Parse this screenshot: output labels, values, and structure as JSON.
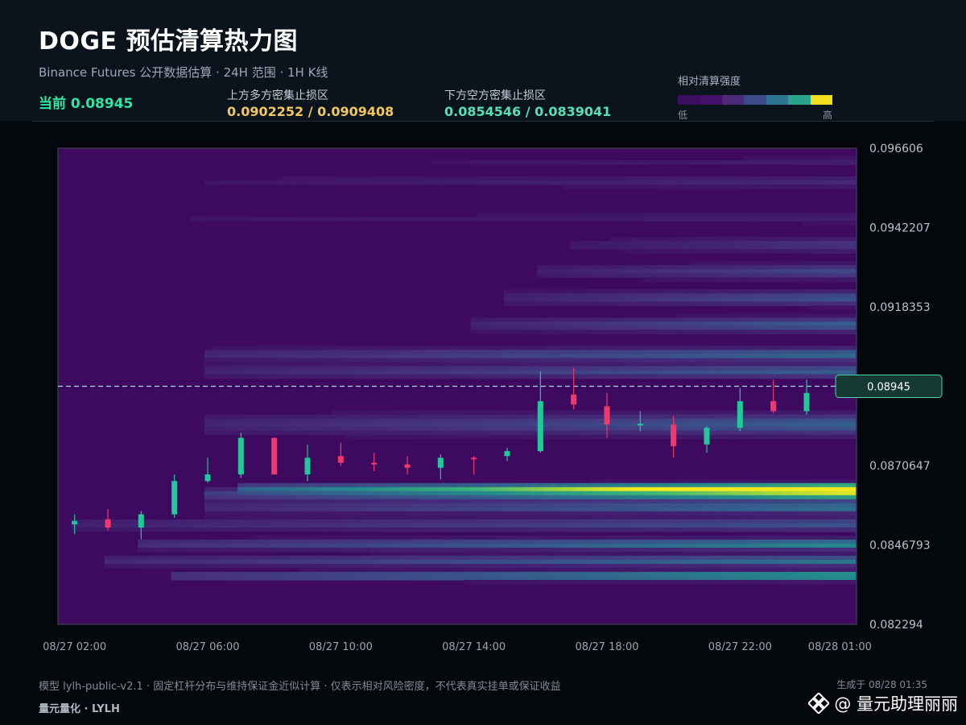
{
  "header": {
    "title": "DOGE 预估清算热力图",
    "subtitle": "Binance Futures 公开数据估算 · 24H 范围 · 1H K线",
    "current_label": "当前 0.08945",
    "upper_label": "上方多方密集止损区",
    "upper_value": "0.0902252 / 0.0909408",
    "lower_label": "下方空方密集止损区",
    "lower_value": "0.0854546 / 0.0839041"
  },
  "legend": {
    "label": "相对清算强度",
    "low": "低",
    "high": "高",
    "colors": [
      "#3a0f5e",
      "#45106a",
      "#4b2a7a",
      "#3d4a8a",
      "#2f7490",
      "#2aa38c",
      "#f0e020"
    ]
  },
  "chart_data": {
    "type": "heatmap",
    "ylim": [
      0.082294,
      0.096606
    ],
    "y_ticks": [
      "0.096606",
      "0.0942207",
      "0.0918353",
      "0.0894500",
      "0.0870647",
      "0.0846793",
      "0.082294"
    ],
    "y_tick_values": [
      0.096606,
      0.0942207,
      0.0918353,
      0.08945,
      0.0870647,
      0.0846793,
      0.082294
    ],
    "x_ticks": [
      "08/27 02:00",
      "08/27 06:00",
      "08/27 10:00",
      "08/27 14:00",
      "08/27 18:00",
      "08/27 22:00",
      "08/28 01:00"
    ],
    "x_tick_hours": [
      2,
      6,
      10,
      14,
      18,
      22,
      25
    ],
    "x_range_hours": [
      1.5,
      25.5
    ],
    "current_price": 0.08945,
    "current_price_label": "0.08945",
    "candles": [
      {
        "hour": 2,
        "open": 0.0853,
        "close": 0.0854,
        "high": 0.0856,
        "low": 0.085
      },
      {
        "hour": 3,
        "open": 0.08545,
        "close": 0.0852,
        "high": 0.08575,
        "low": 0.0851
      },
      {
        "hour": 4,
        "open": 0.0852,
        "close": 0.0856,
        "high": 0.0857,
        "low": 0.08485
      },
      {
        "hour": 5,
        "open": 0.0856,
        "close": 0.0866,
        "high": 0.0868,
        "low": 0.0855
      },
      {
        "hour": 6,
        "open": 0.0866,
        "close": 0.0868,
        "high": 0.0873,
        "low": 0.08655
      },
      {
        "hour": 7,
        "open": 0.0868,
        "close": 0.0879,
        "high": 0.08805,
        "low": 0.0867
      },
      {
        "hour": 8,
        "open": 0.0879,
        "close": 0.0868,
        "high": 0.0879,
        "low": 0.0868
      },
      {
        "hour": 9,
        "open": 0.0868,
        "close": 0.0873,
        "high": 0.0877,
        "low": 0.0866
      },
      {
        "hour": 10,
        "open": 0.08735,
        "close": 0.08715,
        "high": 0.08775,
        "low": 0.08705
      },
      {
        "hour": 11,
        "open": 0.08715,
        "close": 0.0871,
        "high": 0.08745,
        "low": 0.0869
      },
      {
        "hour": 12,
        "open": 0.0871,
        "close": 0.087,
        "high": 0.08735,
        "low": 0.0868
      },
      {
        "hour": 13,
        "open": 0.087,
        "close": 0.0873,
        "high": 0.0874,
        "low": 0.08665
      },
      {
        "hour": 14,
        "open": 0.0873,
        "close": 0.08728,
        "high": 0.08735,
        "low": 0.0868
      },
      {
        "hour": 15,
        "open": 0.08735,
        "close": 0.0875,
        "high": 0.0876,
        "low": 0.0872
      },
      {
        "hour": 16,
        "open": 0.0875,
        "close": 0.089,
        "high": 0.0899,
        "low": 0.08745
      },
      {
        "hour": 17,
        "open": 0.0892,
        "close": 0.0889,
        "high": 0.09,
        "low": 0.08875
      },
      {
        "hour": 18,
        "open": 0.08885,
        "close": 0.0883,
        "high": 0.08925,
        "low": 0.0879
      },
      {
        "hour": 19,
        "open": 0.0883,
        "close": 0.08832,
        "high": 0.0887,
        "low": 0.0881
      },
      {
        "hour": 20,
        "open": 0.0883,
        "close": 0.08765,
        "high": 0.08855,
        "low": 0.0873
      },
      {
        "hour": 21,
        "open": 0.0877,
        "close": 0.0882,
        "high": 0.08825,
        "low": 0.08745
      },
      {
        "hour": 22,
        "open": 0.0882,
        "close": 0.089,
        "high": 0.0894,
        "low": 0.0881
      },
      {
        "hour": 23,
        "open": 0.089,
        "close": 0.0887,
        "high": 0.08965,
        "low": 0.08865
      },
      {
        "hour": 24,
        "open": 0.0887,
        "close": 0.08925,
        "high": 0.08965,
        "low": 0.0886
      },
      {
        "hour": 25,
        "open": 0.0893,
        "close": 0.08945,
        "high": 0.0897,
        "low": 0.0892
      }
    ],
    "bands": [
      {
        "price": 0.0864,
        "start_hour": 10,
        "peak_hour": 25,
        "intensity": 1.0,
        "width": 0.00012
      },
      {
        "price": 0.0862,
        "start_hour": 9,
        "peak_hour": 25,
        "intensity": 0.85,
        "width": 0.00018
      },
      {
        "price": 0.0858,
        "start_hour": 9,
        "peak_hour": 25,
        "intensity": 0.55,
        "width": 0.00015
      },
      {
        "price": 0.0847,
        "start_hour": 7,
        "peak_hour": 25,
        "intensity": 0.65,
        "width": 0.00015
      },
      {
        "price": 0.0842,
        "start_hour": 6,
        "peak_hour": 25,
        "intensity": 0.55,
        "width": 0.00015
      },
      {
        "price": 0.08375,
        "start_hour": 8,
        "peak_hour": 25,
        "intensity": 0.8,
        "width": 0.00012
      },
      {
        "price": 0.0853,
        "start_hour": 5,
        "peak_hour": 25,
        "intensity": 0.4,
        "width": 0.00018
      },
      {
        "price": 0.0883,
        "start_hour": 9,
        "peak_hour": 25,
        "intensity": 0.45,
        "width": 0.0003
      },
      {
        "price": 0.0904,
        "start_hour": 9,
        "peak_hour": 25,
        "intensity": 0.5,
        "width": 0.00018
      },
      {
        "price": 0.0899,
        "start_hour": 9,
        "peak_hour": 25,
        "intensity": 0.45,
        "width": 0.00018
      },
      {
        "price": 0.0913,
        "start_hour": 17,
        "peak_hour": 25,
        "intensity": 0.45,
        "width": 0.0002
      },
      {
        "price": 0.0921,
        "start_hour": 18,
        "peak_hour": 25,
        "intensity": 0.4,
        "width": 0.0002
      },
      {
        "price": 0.0929,
        "start_hour": 19,
        "peak_hour": 25,
        "intensity": 0.35,
        "width": 0.0002
      },
      {
        "price": 0.0937,
        "start_hour": 20,
        "peak_hour": 25,
        "intensity": 0.25,
        "width": 0.0002
      },
      {
        "price": 0.0956,
        "start_hour": 9,
        "peak_hour": 25,
        "intensity": 0.18,
        "width": 0.00015
      },
      {
        "price": 0.0945,
        "start_hour": 6,
        "peak_hour": 25,
        "intensity": 0.12,
        "width": 0.00015
      },
      {
        "price": 0.0962,
        "start_hour": 14,
        "peak_hour": 25,
        "intensity": 0.12,
        "width": 0.00012
      }
    ]
  },
  "footer": {
    "note": "模型 lylh-public-v2.1 · 固定杠杆分布与维持保证金近似计算 · 仅表示相对风险密度，不代表真实挂单或保证收益",
    "generated": "生成于 08/28 01:35",
    "brand": "量元量化 · LYLH",
    "watermark": "@ 量元助理丽丽"
  }
}
